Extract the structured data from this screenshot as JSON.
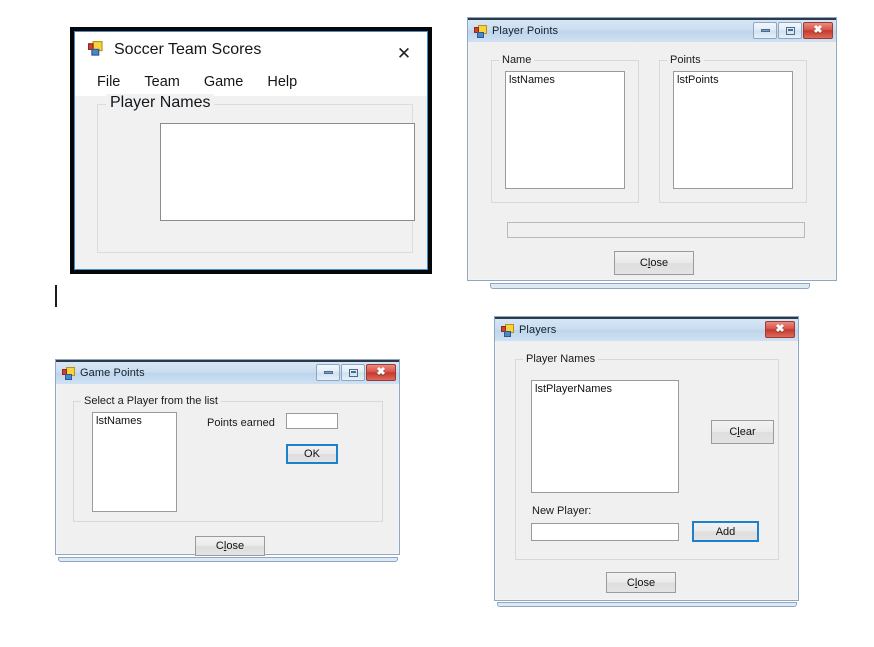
{
  "page": {
    "background": "#ffffff",
    "accent_blue": "#1e80c8",
    "aero_border": "#8ea8c4"
  },
  "main_window": {
    "title": "Soccer Team Scores",
    "icon": "winforms-icon",
    "close_glyph": "✕",
    "menu": [
      {
        "label": "File"
      },
      {
        "label": "Team"
      },
      {
        "label": "Game"
      },
      {
        "label": "Help"
      }
    ],
    "group": {
      "label": "Player Names",
      "listbox_text": ""
    }
  },
  "player_points_window": {
    "title": "Player Points",
    "icon": "winforms-icon",
    "caption_buttons": {
      "minimize": "minimize-icon",
      "maximize": "maximize-icon",
      "close": "✖"
    },
    "name_group": {
      "label": "Name",
      "listbox_text": "lstNames"
    },
    "points_group": {
      "label": "Points",
      "listbox_text": "lstPoints"
    },
    "total_textbox_value": "",
    "close_button": {
      "prefix": "C",
      "accel": "l",
      "suffix": "ose"
    }
  },
  "game_points_window": {
    "title": "Game Points",
    "icon": "winforms-icon",
    "caption_buttons": {
      "minimize": "minimize-icon",
      "maximize": "maximize-icon",
      "close": "✖"
    },
    "group_label": "Select a Player from the list",
    "listbox_text": "lstNames",
    "points_earned_label": "Points earned",
    "points_earned_value": "",
    "ok_button": "OK",
    "close_button": {
      "prefix": "C",
      "accel": "l",
      "suffix": "ose"
    }
  },
  "players_window": {
    "title": "Players",
    "icon": "winforms-icon",
    "caption_buttons": {
      "close": "✖"
    },
    "group_label": "Player Names",
    "listbox_text": "lstPlayerNames",
    "clear_button": {
      "prefix": "C",
      "accel": "l",
      "suffix": "ear"
    },
    "new_player_label": "New Player:",
    "new_player_value": "",
    "add_button": "Add",
    "close_button": {
      "prefix": "C",
      "accel": "l",
      "suffix": "ose"
    }
  }
}
